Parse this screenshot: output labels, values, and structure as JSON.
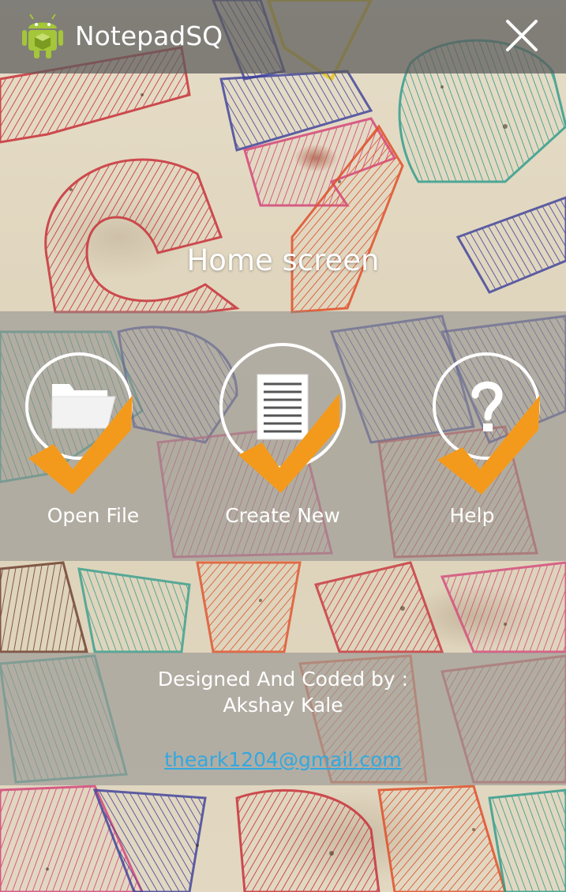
{
  "app": {
    "title": "NotepadSQ",
    "icon": "android-robot-icon",
    "close_icon": "close-icon"
  },
  "main": {
    "heading": "Home screen",
    "actions": [
      {
        "label": "Open File",
        "icon": "folder-icon"
      },
      {
        "label": "Create New",
        "icon": "document-icon"
      },
      {
        "label": "Help",
        "icon": "question-mark-icon"
      }
    ],
    "check_icon": "checkmark-icon"
  },
  "credits": {
    "line1": "Designed And Coded by :",
    "line2": "Akshay Kale",
    "email": "theark1204@gmail.com"
  },
  "colors": {
    "accent_orange": "#f39a1c",
    "link_blue": "#33a8de",
    "android_green": "#a4c639"
  }
}
